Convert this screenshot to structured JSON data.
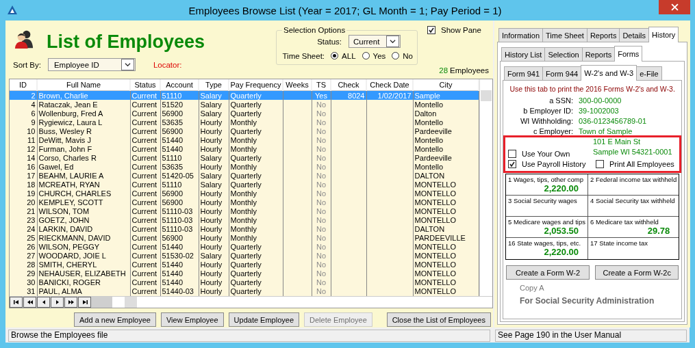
{
  "window": {
    "title": "Employees Browse List (Year = 2017; GL Month = 1; Pay Period = 1)"
  },
  "heading": "List of Employees",
  "sort": {
    "label": "Sort By:",
    "value": "Employee ID"
  },
  "locator": "Locator:",
  "selection_options": {
    "title": "Selection Options",
    "status_label": "Status:",
    "status_value": "Current",
    "timesheet_label": "Time Sheet:",
    "timesheet_options": [
      {
        "label": "ALL",
        "selected": true
      },
      {
        "label": "Yes",
        "selected": false
      },
      {
        "label": "No",
        "selected": false
      }
    ]
  },
  "show_pane": {
    "label": "Show Pane",
    "checked": true
  },
  "employee_count": {
    "number": "28",
    "label": "Employees"
  },
  "table": {
    "columns": [
      "ID",
      "Full Name",
      "Status",
      "Account",
      "Type",
      "Pay Frequency",
      "Weeks",
      "TS",
      "Check",
      "Check Date",
      "City"
    ],
    "rows": [
      {
        "selected": true,
        "ts_dimmed": false,
        "cells": [
          "2",
          "Brown, Charlie",
          "Current",
          "51110",
          "Salary",
          "Quarterly",
          "",
          "Yes",
          "8024",
          "1/02/2017",
          "Sample"
        ]
      },
      {
        "selected": false,
        "ts_dimmed": true,
        "cells": [
          "4",
          "Rataczak, Jean E",
          "Current",
          "51520",
          "Salary",
          "Quarterly",
          "",
          "No",
          "",
          "",
          "Montello"
        ]
      },
      {
        "selected": false,
        "ts_dimmed": true,
        "cells": [
          "6",
          "Wollenburg, Fred A",
          "Current",
          "56900",
          "Salary",
          "Quarterly",
          "",
          "No",
          "",
          "",
          "Dalton"
        ]
      },
      {
        "selected": false,
        "ts_dimmed": true,
        "cells": [
          "9",
          "Rygiewicz, Laura L",
          "Current",
          "53635",
          "Hourly",
          "Monthly",
          "",
          "No",
          "",
          "",
          "Montello"
        ]
      },
      {
        "selected": false,
        "ts_dimmed": true,
        "cells": [
          "10",
          "Buss, Wesley R",
          "Current",
          "56900",
          "Hourly",
          "Quarterly",
          "",
          "No",
          "",
          "",
          "Pardeeville"
        ]
      },
      {
        "selected": false,
        "ts_dimmed": true,
        "cells": [
          "11",
          "DeWitt, Mavis J",
          "Current",
          "51440",
          "Hourly",
          "Monthly",
          "",
          "No",
          "",
          "",
          "Montello"
        ]
      },
      {
        "selected": false,
        "ts_dimmed": true,
        "cells": [
          "12",
          "Furman, John F",
          "Current",
          "51440",
          "Hourly",
          "Monthly",
          "",
          "No",
          "",
          "",
          "Montello"
        ]
      },
      {
        "selected": false,
        "ts_dimmed": true,
        "cells": [
          "14",
          "Corso, Charles R",
          "Current",
          "51110",
          "Salary",
          "Quarterly",
          "",
          "No",
          "",
          "",
          "Pardeeville"
        ]
      },
      {
        "selected": false,
        "ts_dimmed": true,
        "cells": [
          "16",
          "Gawel, Ed",
          "Current",
          "53635",
          "Hourly",
          "Monthly",
          "",
          "No",
          "",
          "",
          "Montello"
        ]
      },
      {
        "selected": false,
        "ts_dimmed": true,
        "cells": [
          "17",
          "BEAHM, LAURIE A",
          "Current",
          "51420-05",
          "Salary",
          "Quarterly",
          "",
          "No",
          "",
          "",
          "DALTON"
        ]
      },
      {
        "selected": false,
        "ts_dimmed": true,
        "cells": [
          "18",
          "MCREATH, RYAN",
          "Current",
          "51110",
          "Salary",
          "Quarterly",
          "",
          "No",
          "",
          "",
          "MONTELLO"
        ]
      },
      {
        "selected": false,
        "ts_dimmed": true,
        "cells": [
          "19",
          "CHURCH, CHARLES",
          "Current",
          "56900",
          "Hourly",
          "Monthly",
          "",
          "No",
          "",
          "",
          "MONTELLO"
        ]
      },
      {
        "selected": false,
        "ts_dimmed": true,
        "cells": [
          "20",
          "KEMPLEY, SCOTT",
          "Current",
          "56900",
          "Hourly",
          "Monthly",
          "",
          "No",
          "",
          "",
          "MONTELLO"
        ]
      },
      {
        "selected": false,
        "ts_dimmed": true,
        "cells": [
          "21",
          "WILSON, TOM",
          "Current",
          "51110-03",
          "Hourly",
          "Monthly",
          "",
          "No",
          "",
          "",
          "MONTELLO"
        ]
      },
      {
        "selected": false,
        "ts_dimmed": true,
        "cells": [
          "23",
          "GOETZ, JOHN",
          "Current",
          "51110-03",
          "Hourly",
          "Monthly",
          "",
          "No",
          "",
          "",
          "MONTELLO"
        ]
      },
      {
        "selected": false,
        "ts_dimmed": true,
        "cells": [
          "24",
          "LARKIN, DAVID",
          "Current",
          "51110-03",
          "Hourly",
          "Monthly",
          "",
          "No",
          "",
          "",
          "DALTON"
        ]
      },
      {
        "selected": false,
        "ts_dimmed": true,
        "cells": [
          "25",
          "RIECKMANN, DAVID",
          "Current",
          "56900",
          "Hourly",
          "Monthly",
          "",
          "No",
          "",
          "",
          "PARDEEVILLE"
        ]
      },
      {
        "selected": false,
        "ts_dimmed": true,
        "cells": [
          "26",
          "WILSON, PEGGY",
          "Current",
          "51440",
          "Hourly",
          "Quarterly",
          "",
          "No",
          "",
          "",
          "MONTELLO"
        ]
      },
      {
        "selected": false,
        "ts_dimmed": true,
        "cells": [
          "27",
          "WOODARD, JOIE L",
          "Current",
          "51530-02",
          "Salary",
          "Quarterly",
          "",
          "No",
          "",
          "",
          "MONTELLO"
        ]
      },
      {
        "selected": false,
        "ts_dimmed": true,
        "cells": [
          "28",
          "SMITH, CHERYL",
          "Current",
          "51440",
          "Hourly",
          "Quarterly",
          "",
          "No",
          "",
          "",
          "MONTELLO"
        ]
      },
      {
        "selected": false,
        "ts_dimmed": true,
        "cells": [
          "29",
          "NEHAUSER, ELIZABETH",
          "Current",
          "51440",
          "Hourly",
          "Quarterly",
          "",
          "No",
          "",
          "",
          "MONTELLO"
        ]
      },
      {
        "selected": false,
        "ts_dimmed": true,
        "cells": [
          "30",
          "BANICKI, ROGER",
          "Current",
          "51440",
          "Hourly",
          "Quarterly",
          "",
          "No",
          "",
          "",
          "MONTELLO"
        ]
      },
      {
        "selected": false,
        "ts_dimmed": true,
        "cells": [
          "31",
          "PAUL, ALMA",
          "Current",
          "51440-03",
          "Hourly",
          "Quarterly",
          "",
          "No",
          "",
          "",
          "MONTELLO"
        ]
      }
    ]
  },
  "buttons": [
    {
      "label": "Add a new Employee",
      "disabled": false
    },
    {
      "label": "View Employee",
      "disabled": false
    },
    {
      "label": "Update Employee",
      "disabled": false
    },
    {
      "label": "Delete Employee",
      "disabled": true
    },
    {
      "label": "Close the List of Employees",
      "disabled": false
    }
  ],
  "tabs": [
    {
      "label": "Information",
      "selected": false
    },
    {
      "label": "Time Sheet",
      "selected": false
    },
    {
      "label": "Reports",
      "selected": false
    },
    {
      "label": "Details",
      "selected": false
    },
    {
      "label": "History",
      "selected": true
    }
  ],
  "history_tabs": [
    {
      "label": "History List",
      "selected": false
    },
    {
      "label": "Selection",
      "selected": false
    },
    {
      "label": "Reports",
      "selected": false
    },
    {
      "label": "Forms",
      "selected": true
    }
  ],
  "form_tabs": [
    {
      "label": "Form 941",
      "selected": false
    },
    {
      "label": "Form 944",
      "selected": false
    },
    {
      "label": "W-2's and W-3",
      "selected": true
    },
    {
      "label": "e-File",
      "selected": false
    }
  ],
  "instruction": "Use this tab to print the 2016 Forms W-2's and W-3.",
  "fields": [
    {
      "label": "a SSN:",
      "value": "300-00-0000"
    },
    {
      "label": "b Employer ID:",
      "value": "39-1002003"
    },
    {
      "label": "WI Withholding:",
      "value": "036-0123456789-01"
    }
  ],
  "employer": {
    "label": "c Employer:",
    "lines": [
      "Town of Sample",
      "101 E Main St",
      "Sample WI 54321-0001"
    ]
  },
  "use_your_own": {
    "label": "Use Your Own",
    "checked": false
  },
  "use_payroll_history": {
    "label": "Use Payroll History",
    "checked": true
  },
  "print_all": {
    "label": "Print All Employees",
    "checked": false
  },
  "w2_boxes": [
    {
      "label": "1 Wages, tips, other comp",
      "value": "2,220.00"
    },
    {
      "label": "2 Federal income tax withheld"
    },
    {
      "label": "3 Social Security wages"
    },
    {
      "label": "4 Social Security tax withheld"
    },
    {
      "label": "5 Medicare wages and tips",
      "value": "2,053.50"
    },
    {
      "label": "6 Medicare tax withheld",
      "value": "29.78"
    },
    {
      "label": "16 State wages, tips, etc.",
      "value": "2,220.00"
    },
    {
      "label": "17 State income tax"
    }
  ],
  "form_buttons": [
    "Create a Form W-2",
    "Create a Form W-2c"
  ],
  "copy": "Copy A",
  "copy_for": "For Social Security Administration",
  "status_bar": {
    "left": "Browse the Employees file",
    "right": "See Page 190 in the User Manual"
  }
}
